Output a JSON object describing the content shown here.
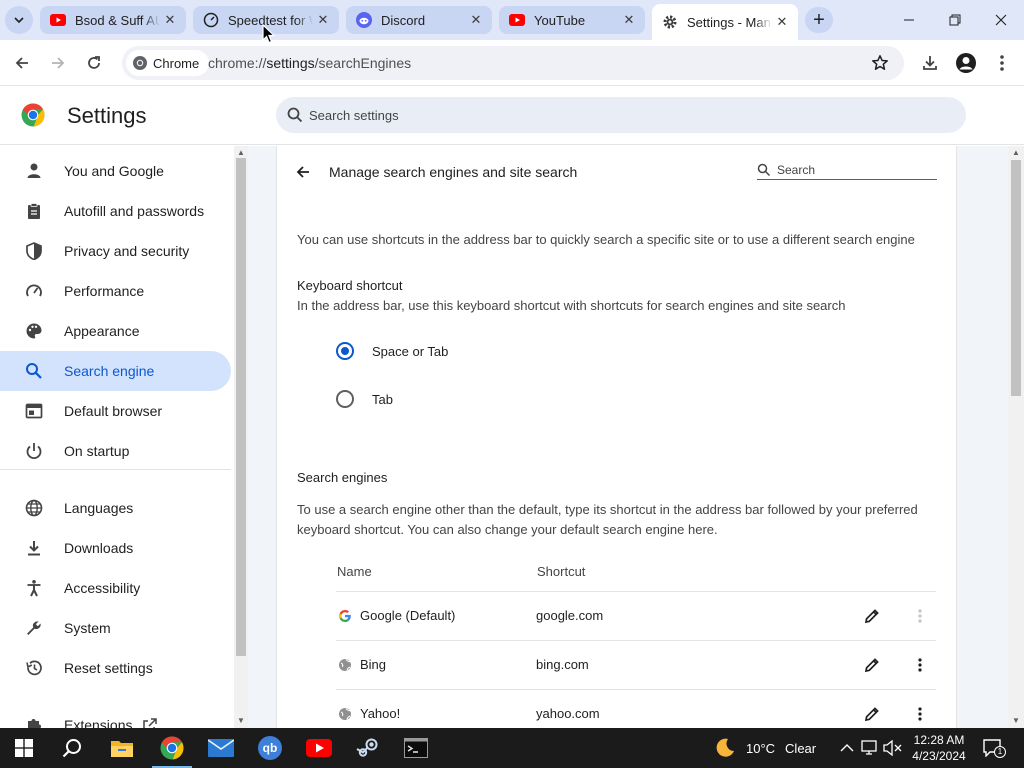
{
  "browser": {
    "tabs": [
      {
        "title": "Bsod & Suff AU",
        "icon": "youtube-icon",
        "active": false
      },
      {
        "title": "Speedtest for W",
        "icon": "speedtest-icon",
        "active": false
      },
      {
        "title": "Discord",
        "icon": "discord-icon",
        "active": false
      },
      {
        "title": "YouTube",
        "icon": "youtube-icon",
        "active": false
      },
      {
        "title": "Settings - Man",
        "icon": "gear-icon",
        "active": true
      }
    ],
    "chip_label": "Chrome",
    "url_scheme": "chrome://",
    "url_host": "settings",
    "url_path": "/searchEngines"
  },
  "settings": {
    "title": "Settings",
    "search_placeholder": "Search settings"
  },
  "sidebar": {
    "items": [
      {
        "label": "You and Google",
        "icon": "person-icon"
      },
      {
        "label": "Autofill and passwords",
        "icon": "clipboard-icon"
      },
      {
        "label": "Privacy and security",
        "icon": "shield-icon"
      },
      {
        "label": "Performance",
        "icon": "speedometer-icon"
      },
      {
        "label": "Appearance",
        "icon": "palette-icon"
      },
      {
        "label": "Search engine",
        "icon": "search-icon",
        "active": true
      },
      {
        "label": "Default browser",
        "icon": "browser-icon"
      },
      {
        "label": "On startup",
        "icon": "power-icon"
      },
      {
        "label": "Languages",
        "icon": "globe-icon"
      },
      {
        "label": "Downloads",
        "icon": "download-icon"
      },
      {
        "label": "Accessibility",
        "icon": "accessibility-icon"
      },
      {
        "label": "System",
        "icon": "wrench-icon"
      },
      {
        "label": "Reset settings",
        "icon": "history-icon"
      },
      {
        "label": "Extensions",
        "icon": "puzzle-icon"
      }
    ]
  },
  "main": {
    "page_title": "Manage search engines and site search",
    "search_placeholder": "Search",
    "intro": "You can use shortcuts in the address bar to quickly search a specific site or to use a different search engine",
    "keyboard_heading": "Keyboard shortcut",
    "keyboard_desc": "In the address bar, use this keyboard shortcut with shortcuts for search engines and site search",
    "radio_options": [
      {
        "label": "Space or Tab",
        "selected": true
      },
      {
        "label": "Tab",
        "selected": false
      }
    ],
    "engines_heading": "Search engines",
    "engines_desc_1": "To use a search engine other than the default, type its shortcut in the address bar followed by your preferred",
    "engines_desc_2": "keyboard shortcut. You can also change your default search engine here.",
    "columns": {
      "name": "Name",
      "shortcut": "Shortcut"
    },
    "engines": [
      {
        "name": "Google (Default)",
        "shortcut": "google.com",
        "icon": "google-icon",
        "more_enabled": false
      },
      {
        "name": "Bing",
        "shortcut": "bing.com",
        "icon": "globe-icon",
        "more_enabled": true
      },
      {
        "name": "Yahoo!",
        "shortcut": "yahoo.com",
        "icon": "globe-icon",
        "more_enabled": true
      }
    ]
  },
  "taskbar": {
    "apps": [
      "start-icon",
      "search-icon",
      "file-explorer-icon",
      "chrome-icon",
      "mail-icon",
      "qbittorrent-icon",
      "youtube-icon",
      "steam-icon",
      "terminal-icon"
    ],
    "weather_temp": "10°C",
    "weather_cond": "Clear",
    "time": "12:28 AM",
    "date": "4/23/2024",
    "notification_count": "1"
  },
  "colors": {
    "accent": "#0b57d0",
    "active_nav_bg": "#d3e3fd",
    "tabstrip_bg": "#dfe7f8"
  }
}
